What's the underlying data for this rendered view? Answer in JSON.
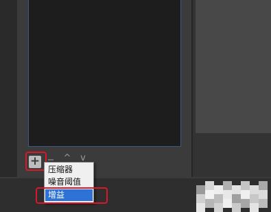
{
  "toolbar": {
    "add_icon": "+",
    "remove_icon": "−",
    "move_up_icon": "^",
    "move_down_icon": "v"
  },
  "menu": {
    "items": [
      {
        "label": "压缩器",
        "selected": false
      },
      {
        "label": "噪音阈值",
        "selected": false
      },
      {
        "label": "增益",
        "selected": true
      }
    ]
  },
  "colors": {
    "highlight_red": "#d9182a",
    "selection_blue": "#2f72d6",
    "list_border": "#3f5b85"
  }
}
